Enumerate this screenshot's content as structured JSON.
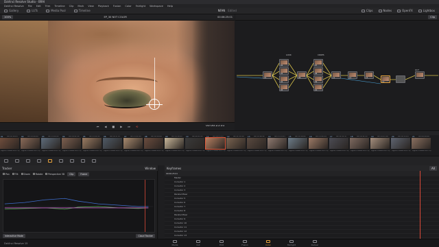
{
  "window": {
    "title": "DaVinci Resolve Studio - BRAI"
  },
  "menu": [
    "DaVinci Resolve",
    "File",
    "Edit",
    "Trim",
    "Timeline",
    "Clip",
    "Mark",
    "View",
    "Playback",
    "Fusion",
    "Color",
    "Fairlight",
    "Workspace",
    "Help"
  ],
  "toolbar": {
    "left": [
      {
        "label": "Gallery",
        "icon": "gallery-icon"
      },
      {
        "label": "LUTs",
        "icon": "lut-icon"
      },
      {
        "label": "Media Pool",
        "icon": "media-pool-icon"
      },
      {
        "label": "Timeline",
        "icon": "timeline-icon"
      }
    ],
    "center_title": "NFAN",
    "center_sub": "Edited",
    "right": [
      {
        "label": "Clips",
        "icon": "clips-icon"
      },
      {
        "label": "Nodes",
        "icon": "nodes-icon"
      },
      {
        "label": "OpenFX",
        "icon": "openfx-icon"
      },
      {
        "label": "Lightbox",
        "icon": "lightbox-icon"
      }
    ]
  },
  "viewer": {
    "zoom": "100%",
    "clip_name": "EP_30 NOT COLOR",
    "timecode_top": "00:06:25:01",
    "timecode": "00:06:25:01"
  },
  "nodes_header": {
    "zoom": "Clip",
    "title": "Clip"
  },
  "nodes": [
    {
      "label": "01"
    },
    {
      "label": "02"
    },
    {
      "label": "03"
    },
    {
      "label": "04"
    },
    {
      "label": "05"
    },
    {
      "label": "06"
    },
    {
      "label": "07"
    },
    {
      "label": "08"
    },
    {
      "label": "09"
    },
    {
      "label": "10"
    },
    {
      "label": "11"
    },
    {
      "label": "12"
    },
    {
      "label": "13"
    },
    {
      "label": "14"
    }
  ],
  "node_groups": [
    {
      "label": "LOOK"
    },
    {
      "label": "CROPS"
    },
    {
      "label": "OUT"
    }
  ],
  "clips": [
    {
      "num": "01",
      "tc": "00:24:19:05",
      "label": "Apple ProRes 422 HQ"
    },
    {
      "num": "02",
      "tc": "00:14:49:00",
      "label": "Apple ProRes 422 HQ"
    },
    {
      "num": "03",
      "tc": "00:13:09:21",
      "label": "Apple ProRes 422 HQ"
    },
    {
      "num": "04",
      "tc": "00:14:22:12",
      "label": "Apple ProRes 422 HQ"
    },
    {
      "num": "05",
      "tc": "00:15:20:11",
      "label": "Apple ProRes 422 HQ"
    },
    {
      "num": "06",
      "tc": "00:10:17:07",
      "label": "Apple ProRes 422 HQ"
    },
    {
      "num": "07",
      "tc": "00:13:21:09",
      "label": "Apple ProRes 422 HQ"
    },
    {
      "num": "08",
      "tc": "00:12:09:08",
      "label": "Apple ProRes 422 HQ"
    },
    {
      "num": "09",
      "tc": "00:10:16:21",
      "label": "Apple ProRes 422 HQ"
    },
    {
      "num": "10",
      "tc": "00:09:45:11",
      "label": "Apple ProRes 422 HQ"
    },
    {
      "num": "11",
      "tc": "00:06:25:01",
      "label": "Apple ProRes 422 HQ"
    },
    {
      "num": "12",
      "tc": "00:12:11:08",
      "label": "Apple ProRes 422 HQ"
    },
    {
      "num": "13",
      "tc": "00:11:46:12",
      "label": "Apple ProRes 422 HQ"
    },
    {
      "num": "14",
      "tc": "00:15:15:03",
      "label": "Apple ProRes 422 HQ"
    },
    {
      "num": "15",
      "tc": "00:11:26:02",
      "label": "Apple ProRes 422 HQ"
    },
    {
      "num": "16",
      "tc": "00:15:48:14",
      "label": "Apple ProRes 422 HQ"
    },
    {
      "num": "17",
      "tc": "00:12:51:17",
      "label": "Apple ProRes 422 HQ"
    },
    {
      "num": "18",
      "tc": "00:18:12:11",
      "label": "Apple ProRes 422 HQ"
    },
    {
      "num": "19",
      "tc": "00:10:05:16",
      "label": "Apple ProRes 422 HQ"
    },
    {
      "num": "20",
      "tc": "00:14:15:05",
      "label": "Apple ProRes 422 HQ"
    },
    {
      "num": "21",
      "tc": "00:09:26:06",
      "label": "Apple ProRes 422 HQ"
    }
  ],
  "tracker": {
    "title": "Tracker",
    "checks": [
      "Pan",
      "Tilt",
      "Zoom",
      "Rotate",
      "Perspective 3D"
    ],
    "mode": "Clip",
    "frame_label": "Frame",
    "readouts": [
      "0.00",
      "0.00",
      "0.00",
      "0.00"
    ],
    "footer_left": "Interactive Mode",
    "footer_right": "Cloud Tracker"
  },
  "window_panel": {
    "title": "Window"
  },
  "keyframes": {
    "title": "Keyframes",
    "mode": "All",
    "timecode": "00:06:25:01",
    "rows": [
      "Master",
      "Corrector 1",
      "Corrector 2",
      "Corrector 3",
      "Parallel Mixer",
      "Corrector 5",
      "Corrector 6",
      "Corrector 7",
      "Corrector 8",
      "Parallel Mixer",
      "Corrector 9",
      "Corrector 10",
      "Corrector 11",
      "Corrector 12",
      "Corrector 13"
    ]
  },
  "pages": [
    {
      "label": "Media",
      "icon": "media-page-icon"
    },
    {
      "label": "Cut",
      "icon": "cut-page-icon"
    },
    {
      "label": "Edit",
      "icon": "edit-page-icon"
    },
    {
      "label": "Fusion",
      "icon": "fusion-page-icon"
    },
    {
      "label": "Color",
      "icon": "color-page-icon",
      "active": true
    },
    {
      "label": "Fairlight",
      "icon": "fairlight-page-icon"
    },
    {
      "label": "Deliver",
      "icon": "deliver-page-icon"
    }
  ],
  "brand": "DaVinci Resolve 15",
  "colors": {
    "accent": "#e8a33c",
    "playhead": "#e04a3a",
    "bg": "#1b1b1d"
  }
}
